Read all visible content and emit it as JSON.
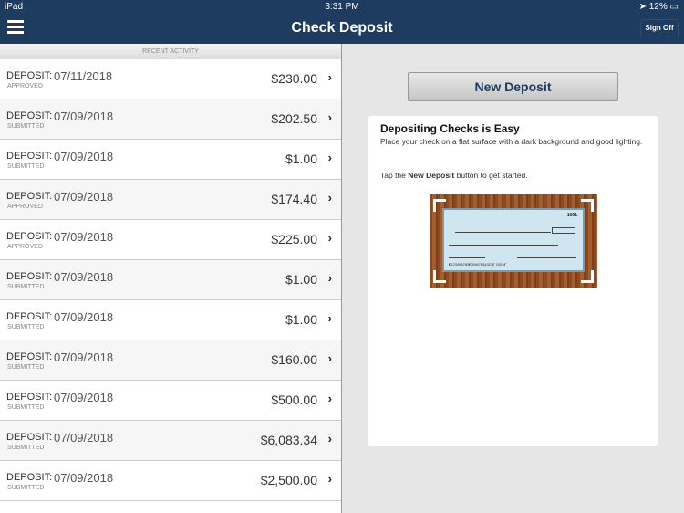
{
  "status_bar": {
    "device": "iPad",
    "time": "3:31 PM",
    "battery": "12%"
  },
  "header": {
    "title": "Check Deposit",
    "sign_off": "Sign Off"
  },
  "recent": {
    "heading": "RECENT ACTIVITY",
    "items": [
      {
        "label": "DEPOSIT:",
        "date": "07/11/2018",
        "status": "APPROVED",
        "amount": "$230.00"
      },
      {
        "label": "DEPOSIT:",
        "date": "07/09/2018",
        "status": "SUBMITTED",
        "amount": "$202.50"
      },
      {
        "label": "DEPOSIT:",
        "date": "07/09/2018",
        "status": "SUBMITTED",
        "amount": "$1.00"
      },
      {
        "label": "DEPOSIT:",
        "date": "07/09/2018",
        "status": "APPROVED",
        "amount": "$174.40"
      },
      {
        "label": "DEPOSIT:",
        "date": "07/09/2018",
        "status": "APPROVED",
        "amount": "$225.00"
      },
      {
        "label": "DEPOSIT:",
        "date": "07/09/2018",
        "status": "SUBMITTED",
        "amount": "$1.00"
      },
      {
        "label": "DEPOSIT:",
        "date": "07/09/2018",
        "status": "SUBMITTED",
        "amount": "$1.00"
      },
      {
        "label": "DEPOSIT:",
        "date": "07/09/2018",
        "status": "SUBMITTED",
        "amount": "$160.00"
      },
      {
        "label": "DEPOSIT:",
        "date": "07/09/2018",
        "status": "SUBMITTED",
        "amount": "$500.00"
      },
      {
        "label": "DEPOSIT:",
        "date": "07/09/2018",
        "status": "SUBMITTED",
        "amount": "$6,083.34"
      },
      {
        "label": "DEPOSIT:",
        "date": "07/09/2018",
        "status": "SUBMITTED",
        "amount": "$2,500.00"
      }
    ]
  },
  "main": {
    "new_deposit": "New Deposit",
    "card_title": "Depositing Checks is Easy",
    "card_text": "Place your check on a flat surface with a dark background and good lighting.",
    "tap_prefix": "Tap the ",
    "tap_bold": "New Deposit",
    "tap_suffix": " button to get started.",
    "check_number": "1001",
    "check_micr": "⑆123456789⑆ 0987654321⑈ 1001⑈"
  }
}
